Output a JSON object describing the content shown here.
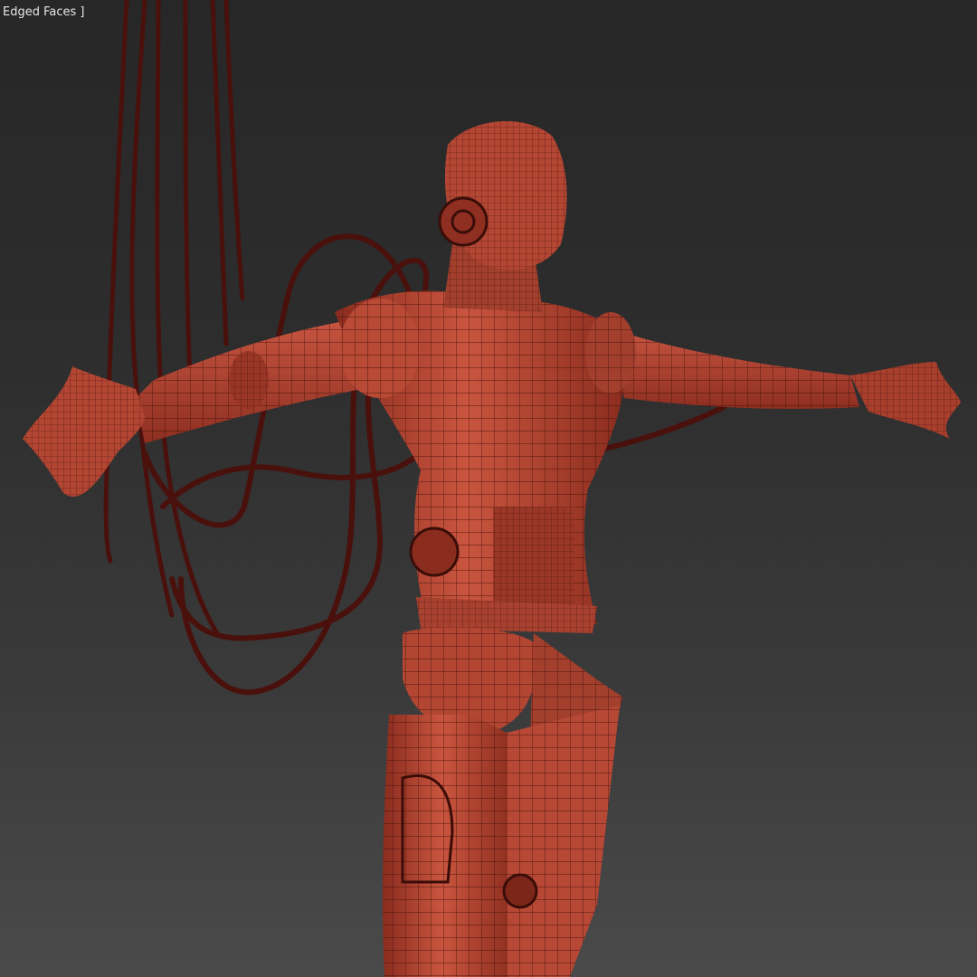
{
  "viewport": {
    "label": "Edged Faces ]",
    "background_top": "#272727",
    "background_bottom": "#4a4a4a"
  },
  "model": {
    "shading": "edged-faces",
    "surface_color": "#c4503f",
    "shadow_color": "#7a2418",
    "wire_color": "#3a0d08",
    "cable_color": "#4a100c"
  }
}
